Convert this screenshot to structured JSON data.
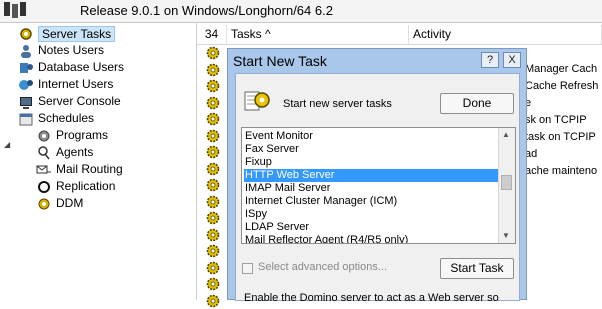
{
  "header": {
    "release": "Release 9.0.1 on Windows/Longhorn/64 6.2"
  },
  "tree": {
    "items": [
      {
        "label": "Server Tasks",
        "icon": "gear-icon",
        "selected": true
      },
      {
        "label": "Notes Users",
        "icon": "user-icon"
      },
      {
        "label": "Database Users",
        "icon": "database-users-icon"
      },
      {
        "label": "Internet Users",
        "icon": "internet-users-icon"
      },
      {
        "label": "Server Console",
        "icon": "console-icon"
      },
      {
        "label": "Schedules",
        "icon": "schedules-icon"
      },
      {
        "label": "Programs",
        "icon": "programs-icon"
      },
      {
        "label": "Agents",
        "icon": "agents-icon"
      },
      {
        "label": "Mail Routing",
        "icon": "mail-routing-icon"
      },
      {
        "label": "Replication",
        "icon": "replication-icon"
      },
      {
        "label": "DDM",
        "icon": "ddm-icon"
      }
    ]
  },
  "grid": {
    "count": "34",
    "col_tasks": "Tasks ^",
    "col_activity": "Activity",
    "activity_values": [
      "Manager Cach",
      "Cache Refresh",
      "e",
      "sk on TCPIP",
      "task on TCPIP",
      "ad",
      "ache mainteno"
    ]
  },
  "dialog": {
    "title": "Start New Task",
    "help_btn": "?",
    "close_btn": "X",
    "subtitle": "Start new server tasks",
    "done_btn": "Done",
    "tasks": [
      "Event Monitor",
      "Fax Server",
      "Fixup",
      "HTTP Web Server",
      "IMAP Mail Server",
      "Internet Cluster Manager (ICM)",
      "ISpy",
      "LDAP Server",
      "Mail Reflector Agent (R4/R5 only)"
    ],
    "selected_task": "HTTP Web Server",
    "advanced_label": "Select advanced options...",
    "start_btn": "Start Task",
    "description": "Enable the Domino server to act as a Web server so"
  },
  "colors": {
    "dialog_frame": "#a9c7ea",
    "selection": "#3399ff",
    "tree_selection": "#cce4f7"
  }
}
